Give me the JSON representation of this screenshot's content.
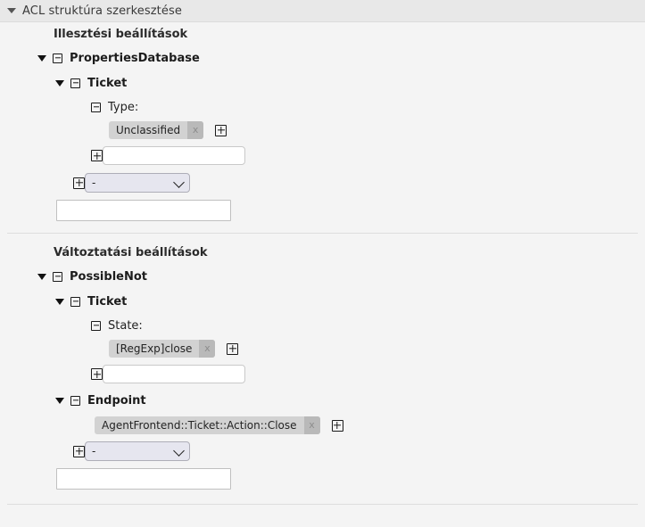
{
  "header": {
    "title": "ACL struktúra szerkesztése",
    "caret_icon": "caret-down-icon"
  },
  "match_section": {
    "title": "Illesztési beállítások",
    "root": {
      "label": "PropertiesDatabase",
      "expander_icon": "caret-down-icon",
      "collapse_icon": "minus-box-icon"
    },
    "child": {
      "label": "Ticket",
      "expander_icon": "caret-down-icon",
      "collapse_icon": "minus-box-icon"
    },
    "field": {
      "label": "Type:",
      "collapse_icon": "minus-box-icon",
      "chips": [
        {
          "label": "Unclassified",
          "remove_label": "x"
        }
      ],
      "add_icon": "plus-box-icon"
    },
    "new_value_row": {
      "add_icon": "plus-box-icon",
      "input_value": "",
      "input_placeholder": ""
    },
    "new_key_row": {
      "add_icon": "plus-box-icon",
      "select_value": "-",
      "select_options": [
        "-"
      ]
    },
    "new_section_input": {
      "value": "",
      "placeholder": ""
    }
  },
  "change_section": {
    "title": "Változtatási beállítások",
    "root": {
      "label": "PossibleNot",
      "expander_icon": "caret-down-icon",
      "collapse_icon": "minus-box-icon"
    },
    "ticket": {
      "label": "Ticket",
      "expander_icon": "caret-down-icon",
      "collapse_icon": "minus-box-icon"
    },
    "state_field": {
      "label": "State:",
      "collapse_icon": "minus-box-icon",
      "chips": [
        {
          "label": "[RegExp]close",
          "remove_label": "x"
        }
      ],
      "add_icon": "plus-box-icon"
    },
    "state_new_row": {
      "add_icon": "plus-box-icon",
      "input_value": "",
      "input_placeholder": ""
    },
    "endpoint": {
      "label": "Endpoint",
      "expander_icon": "caret-down-icon",
      "collapse_icon": "minus-box-icon",
      "chips": [
        {
          "label": "AgentFrontend::Ticket::Action::Close",
          "remove_label": "x"
        }
      ],
      "add_icon": "plus-box-icon"
    },
    "new_key_row": {
      "add_icon": "plus-box-icon",
      "select_value": "-",
      "select_options": [
        "-"
      ]
    },
    "new_section_input": {
      "value": "",
      "placeholder": ""
    }
  },
  "colors": {
    "header_bg": "#e8e8e8",
    "body_bg": "#f4f4f4",
    "chip_bg": "#d2d2d2",
    "chip_x_bg": "#b9b9b9",
    "select_bg": "#e6e6ef",
    "divider": "#dddddd"
  }
}
